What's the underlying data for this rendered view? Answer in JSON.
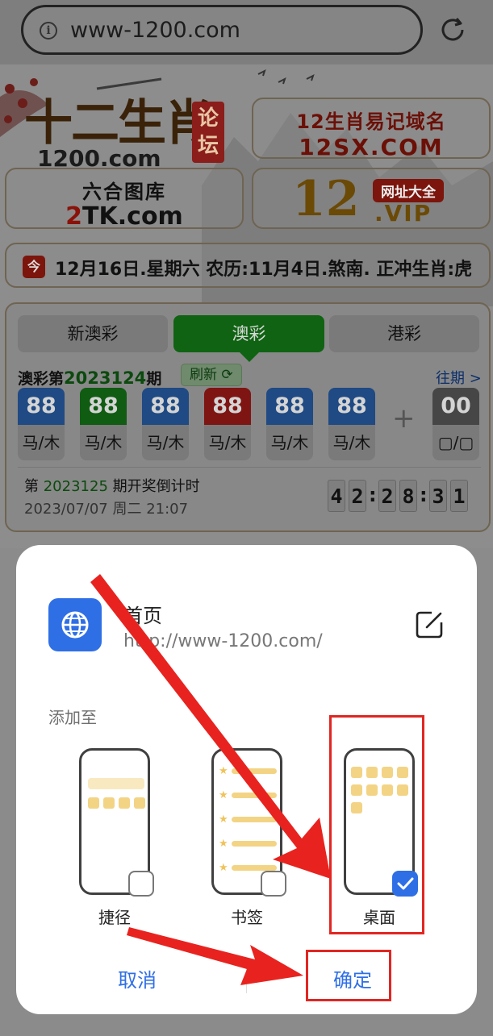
{
  "browser": {
    "url": "www-1200.com"
  },
  "site": {
    "logo_main": "十二生肖",
    "logo_sub": "1200.com",
    "logo_seal": "论坛",
    "banners": [
      {
        "line1": "12生肖易记域名",
        "line2": "12SX.COM"
      },
      {
        "line1": "六合图库",
        "line2_prefix": "2",
        "line2_rest": "TK.com"
      },
      {
        "big": "12",
        "tag": "网址大全",
        "vip": ".VIP"
      }
    ],
    "date_icon": "今",
    "date_text": "12月16日.星期六 农历:11月4日.煞南. 正冲生肖:虎"
  },
  "lottery": {
    "tabs": [
      "新澳彩",
      "澳彩",
      "港彩"
    ],
    "active_tab": 1,
    "issue_prefix": "澳彩第",
    "issue_number": "2023124",
    "issue_suffix": "期",
    "refresh_label": "刷新 ⟳",
    "history_label": "往期 >",
    "balls": [
      {
        "num": "88",
        "label": "马/木",
        "color": "blue"
      },
      {
        "num": "88",
        "label": "马/木",
        "color": "green"
      },
      {
        "num": "88",
        "label": "马/木",
        "color": "blue"
      },
      {
        "num": "88",
        "label": "马/木",
        "color": "red"
      },
      {
        "num": "88",
        "label": "马/木",
        "color": "blue"
      },
      {
        "num": "88",
        "label": "马/木",
        "color": "blue"
      }
    ],
    "plus": "+",
    "special_ball": {
      "num": "00",
      "label": "▢/▢",
      "color": "gray"
    },
    "countdown_prefix": "第 ",
    "countdown_issue": "2023125",
    "countdown_suffix": " 期开奖倒计时",
    "countdown_date": "2023/07/07 周二 21:07",
    "countdown_digits": [
      "4",
      "2",
      "2",
      "8",
      "3",
      "1"
    ]
  },
  "sheet": {
    "title": "首页",
    "url": "http://www-1200.com/",
    "add_to_label": "添加至",
    "options": [
      {
        "label": "捷径",
        "checked": false
      },
      {
        "label": "书签",
        "checked": false
      },
      {
        "label": "桌面",
        "checked": true
      }
    ],
    "cancel_label": "取消",
    "confirm_label": "确定"
  },
  "colors": {
    "accent": "#2f6fe6",
    "annotation": "#e12622",
    "tab_active": "#0f6312"
  },
  "icons": [
    "info-icon",
    "reload-icon",
    "globe-icon",
    "edit-icon",
    "check-icon",
    "refresh-icon"
  ]
}
